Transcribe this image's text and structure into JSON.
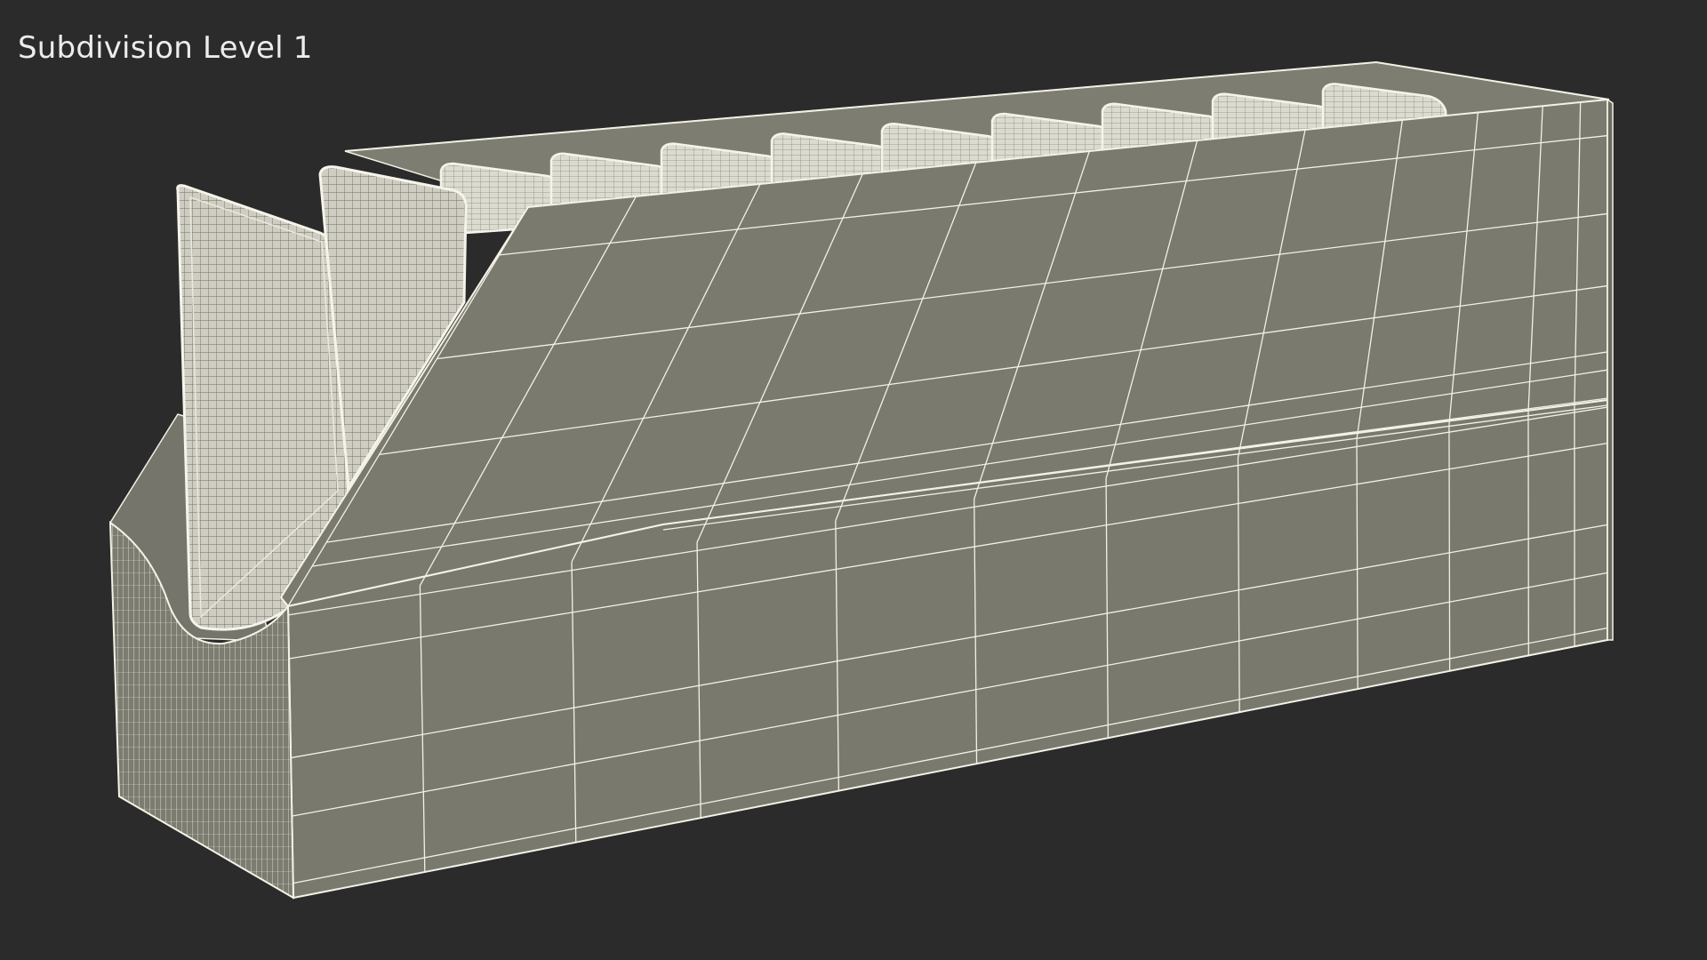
{
  "viewport": {
    "label": "Subdivision Level 1",
    "background": "#2b2b2b"
  },
  "model": {
    "description_icon": "wireframe-box-icon",
    "pack_count": 11,
    "colors": {
      "surface": "#7b7a6f",
      "surface_top": "#858478",
      "wire": "#f4f2e6",
      "pack": "#d9d8cd"
    }
  }
}
